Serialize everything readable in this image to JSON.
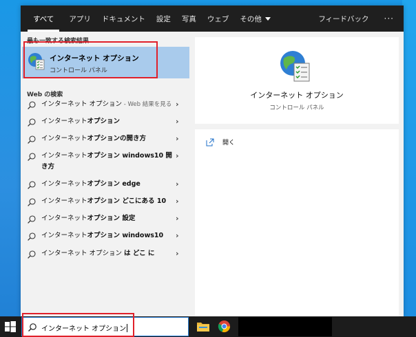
{
  "topbar": {
    "tabs": [
      {
        "label": "すべて",
        "active": true
      },
      {
        "label": "アプリ"
      },
      {
        "label": "ドキュメント"
      },
      {
        "label": "設定"
      },
      {
        "label": "写真"
      },
      {
        "label": "ウェブ"
      },
      {
        "label": "その他"
      }
    ],
    "feedback_label": "フィードバック",
    "more_label": "···"
  },
  "best_match": {
    "section_label": "最も一致する検索結果",
    "title": "インターネット オプション",
    "subtitle": "コントロール パネル",
    "icon": "internet-options-icon"
  },
  "web": {
    "section_label": "Web の検索",
    "results": [
      {
        "normal": "インターネット オプション",
        "bold": "",
        "suffix": " - Web 結果を見る"
      },
      {
        "normal": "インターネット",
        "bold": "オプション",
        "suffix": ""
      },
      {
        "normal": "インターネット",
        "bold": "オプションの開き方",
        "suffix": ""
      },
      {
        "normal": "インターネット",
        "bold": "オプション windows10 開き方",
        "suffix": ""
      },
      {
        "normal": "インターネット",
        "bold": "オプション edge",
        "suffix": ""
      },
      {
        "normal": "インターネット",
        "bold": "オプション どこにある 10",
        "suffix": ""
      },
      {
        "normal": "インターネット",
        "bold": "オプション 設定",
        "suffix": ""
      },
      {
        "normal": "インターネット",
        "bold": "オプション windows10",
        "suffix": ""
      },
      {
        "normal": "インターネット オプション ",
        "bold": "は どこ に",
        "suffix": ""
      }
    ]
  },
  "preview": {
    "title": "インターネット オプション",
    "subtitle": "コントロール パネル",
    "open_label": "開く"
  },
  "taskbar": {
    "search_value": "インターネット オプション"
  },
  "colors": {
    "highlight": "#a9cbec",
    "annotation_red": "#e0202a",
    "topbar": "#1f1f1f"
  }
}
